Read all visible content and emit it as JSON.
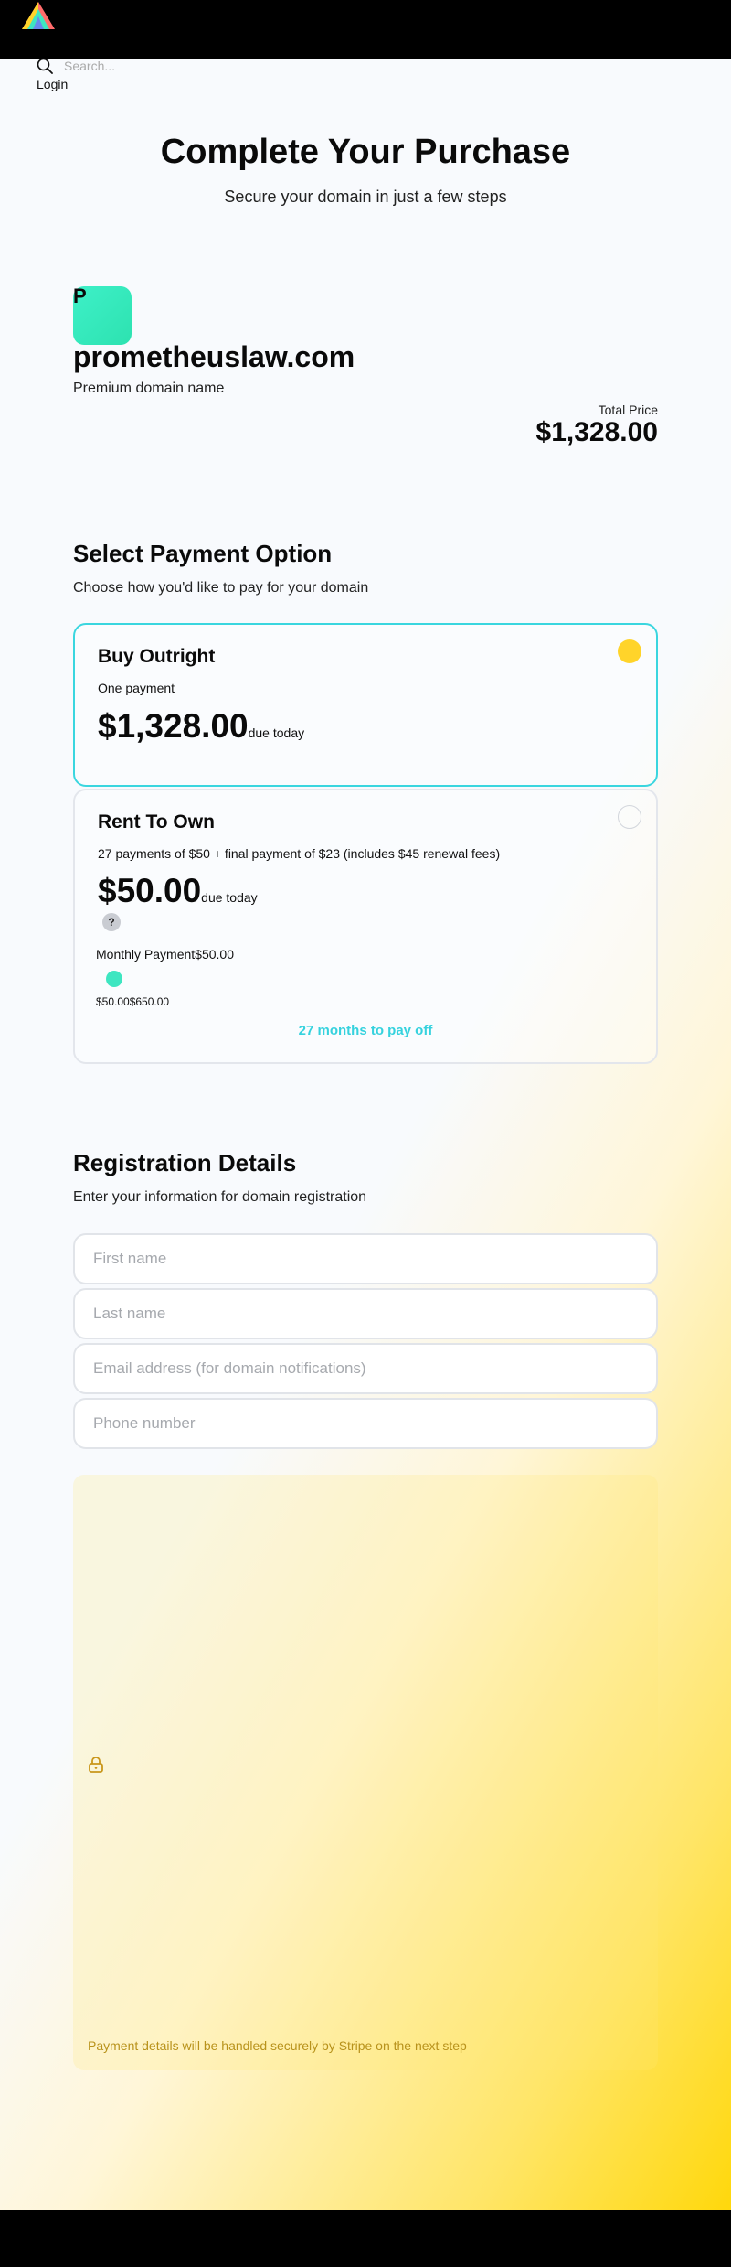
{
  "header": {
    "search_placeholder": "Search...",
    "login_label": "Login"
  },
  "hero": {
    "title": "Complete Your Purchase",
    "subtitle": "Secure your domain in just a few steps"
  },
  "domain": {
    "avatar_letter": "P",
    "name": "prometheuslaw.com",
    "tag": "Premium domain name",
    "total_label": "Total Price",
    "total_value": "$1,328.00"
  },
  "payment": {
    "title": "Select Payment Option",
    "subtitle": "Choose how you'd like to pay for your domain",
    "options": [
      {
        "title": "Buy Outright",
        "description": "One payment",
        "price": "$1,328.00",
        "due_label": "due today",
        "selected": true
      },
      {
        "title": "Rent To Own",
        "description": "27 payments of $50 + final payment of $23 (includes $45 renewal fees)",
        "price": "$50.00",
        "due_label": "due today",
        "selected": false,
        "help_label": "?",
        "monthly_label": "Monthly Payment",
        "monthly_value": "$50.00",
        "slider_value": 50,
        "slider_min": 50,
        "slider_max": 650,
        "range_min": "$50.00",
        "range_max": "$650.00",
        "payoff_text": "27 months to pay off"
      }
    ]
  },
  "registration": {
    "title": "Registration Details",
    "subtitle": "Enter your information for domain registration",
    "fields": {
      "first_name": "First name",
      "last_name": "Last name",
      "email": "Email address (for domain notifications)",
      "phone": "Phone number"
    }
  },
  "stripe": {
    "note": "Payment details will be handled securely by Stripe on the next step",
    "icon": "lock-icon"
  },
  "colors": {
    "accent_teal": "#3ad6df",
    "accent_mint": "#3ee6c1",
    "accent_yellow": "#ffd42a",
    "note_gold": "#b8921b"
  }
}
